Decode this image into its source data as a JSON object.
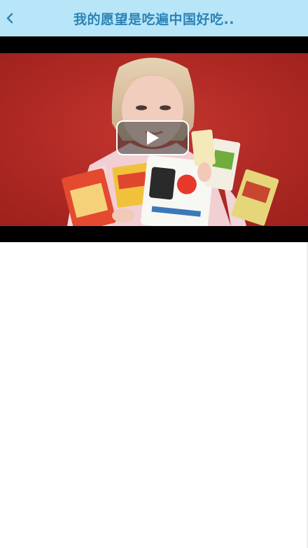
{
  "header": {
    "title": "我的愿望是吃遍中国好吃..",
    "background": "#b8e6f8",
    "title_color": "#2c83b6",
    "back_icon": "chevron-left-icon"
  },
  "video": {
    "play_icon": "play-icon",
    "backdrop_color": "#b52a25"
  }
}
